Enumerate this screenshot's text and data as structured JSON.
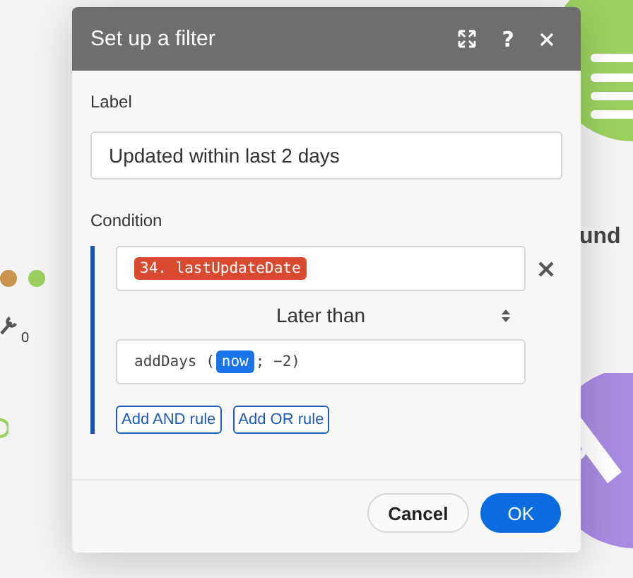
{
  "canvas": {
    "module_label": "und",
    "wrench_count": "0"
  },
  "dialog": {
    "title": "Set up a filter",
    "help_glyph": "?",
    "label_field": {
      "label": "Label",
      "value": "Updated within last 2 days"
    },
    "condition": {
      "label": "Condition",
      "rules": [
        {
          "field_token": "34. lastUpdateDate",
          "operator": "Later than",
          "value_parts": [
            {
              "kind": "text",
              "text": "addDays ("
            },
            {
              "kind": "token",
              "text": "now"
            },
            {
              "kind": "text",
              "text": "; −2)"
            }
          ]
        }
      ],
      "add_buttons": [
        "Add AND rule",
        "Add OR rule"
      ]
    },
    "buttons": [
      {
        "label": "Cancel",
        "kind": "secondary"
      },
      {
        "label": "OK",
        "kind": "primary"
      }
    ]
  }
}
